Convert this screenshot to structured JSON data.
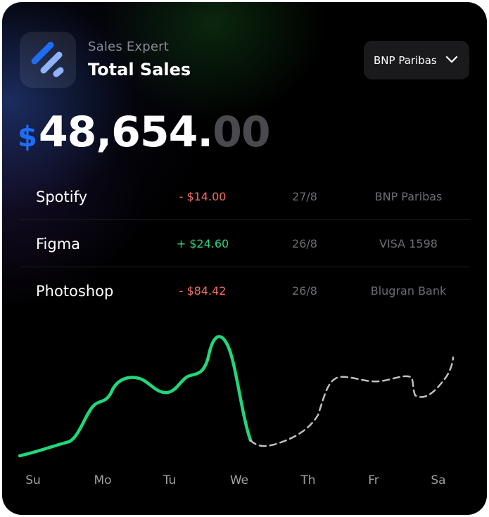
{
  "header": {
    "subtitle": "Sales Expert",
    "title": "Total Sales",
    "logo_icon": "stripes-logo-icon"
  },
  "bank_select": {
    "selected": "BNP Paribas",
    "icon": "chevron-down-icon"
  },
  "total": {
    "currency": "$",
    "integer": "48,654.",
    "decimal": "00"
  },
  "transactions": [
    {
      "name": "Spotify",
      "amount": "- $14.00",
      "direction": "negative",
      "date": "27/8",
      "account": "BNP Paribas"
    },
    {
      "name": "Figma",
      "amount": "+ $24.60",
      "direction": "positive",
      "date": "26/8",
      "account": "VISA 1598"
    },
    {
      "name": "Photoshop",
      "amount": "- $84.42",
      "direction": "negative",
      "date": "26/8",
      "account": "Blugran Bank"
    }
  ],
  "colors": {
    "accent_blue": "#1e6ef5",
    "positive": "#2fd37a",
    "negative": "#f07067",
    "line_actual": "#1fd87a",
    "line_forecast": "#bfbfc4"
  },
  "chart_data": {
    "type": "line",
    "categories": [
      "Su",
      "Mo",
      "Tu",
      "We",
      "Th",
      "Fr",
      "Sa"
    ],
    "series": [
      {
        "style": "solid"
      },
      {
        "style": "dashed"
      }
    ]
  }
}
